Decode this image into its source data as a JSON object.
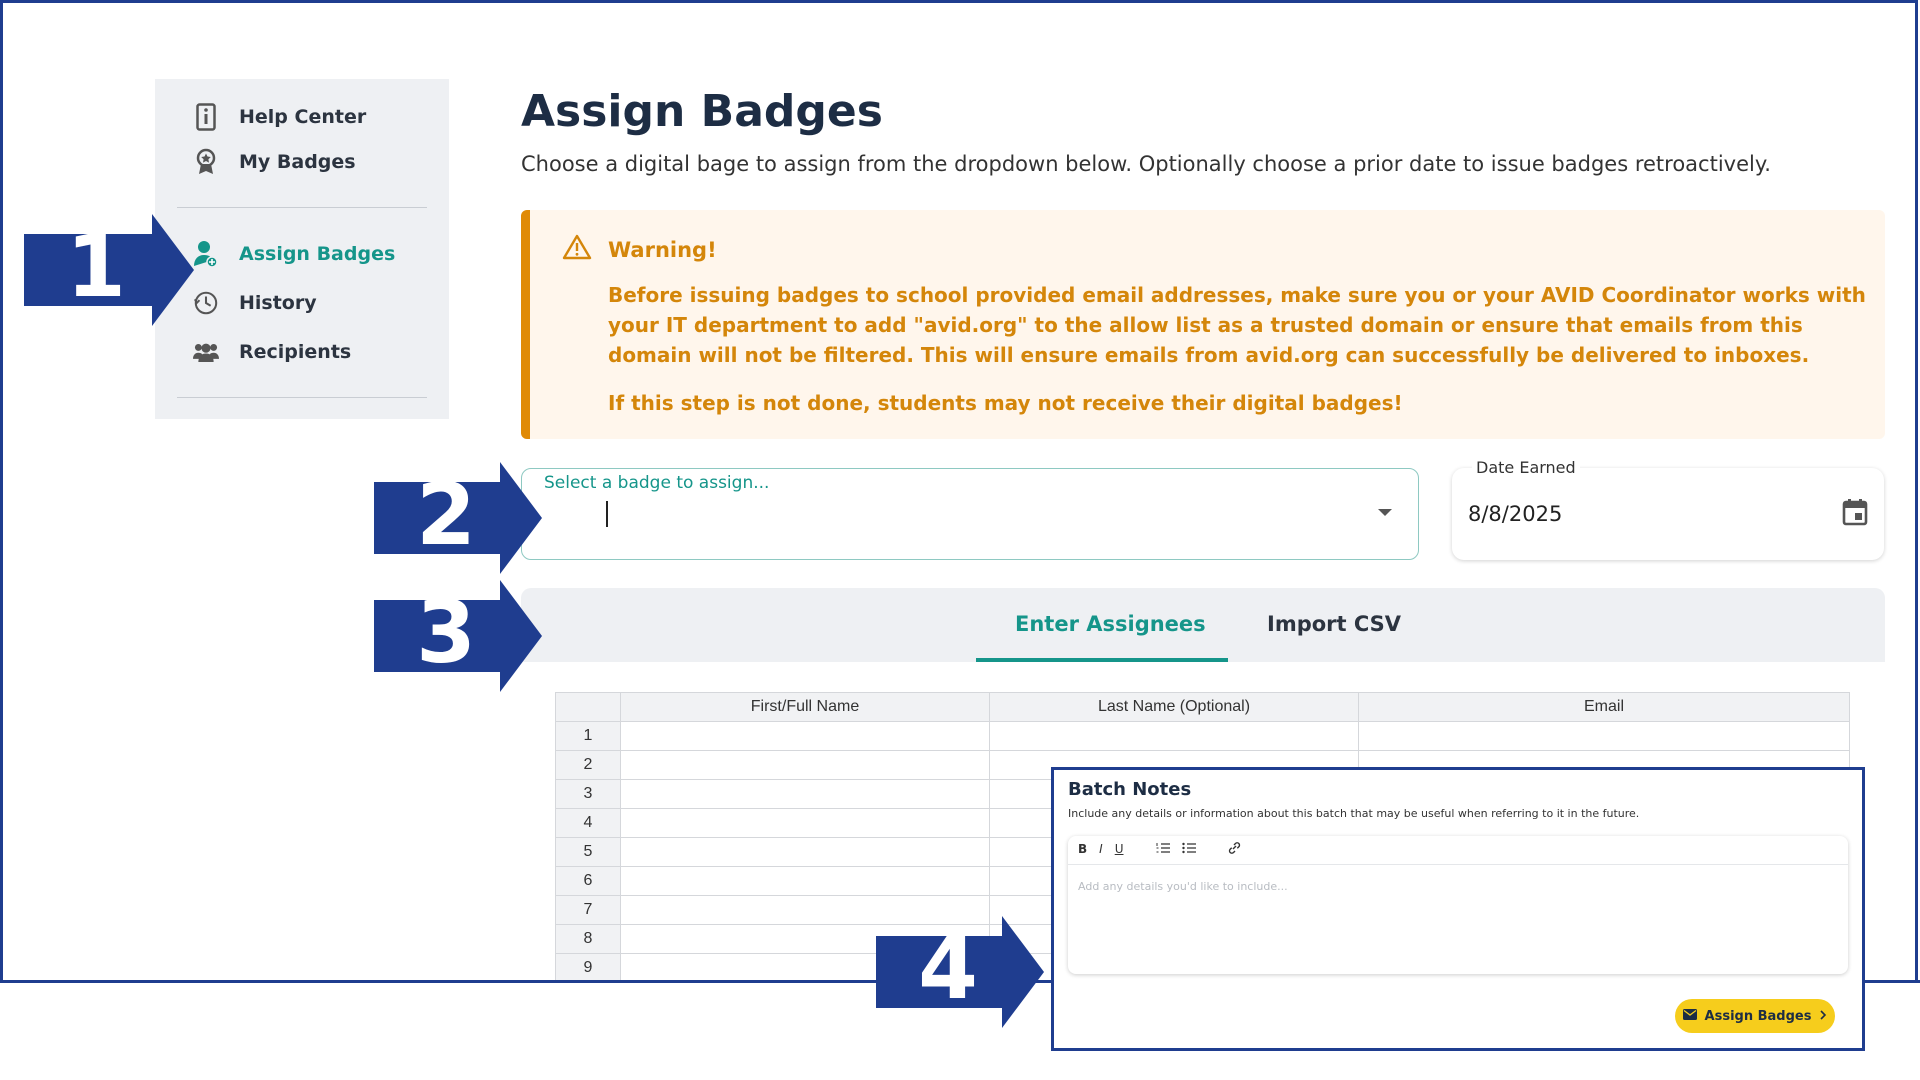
{
  "sidebar": {
    "items": [
      {
        "label": "Help Center",
        "icon": "info-icon"
      },
      {
        "label": "My Badges",
        "icon": "award-icon"
      },
      {
        "label": "Assign Badges",
        "icon": "user-add-icon",
        "active": true
      },
      {
        "label": "History",
        "icon": "clock-history-icon"
      },
      {
        "label": "Recipients",
        "icon": "users-icon"
      }
    ]
  },
  "main": {
    "title": "Assign Badges",
    "subtitle": "Choose a digital bage to assign from the dropdown below. Optionally choose a prior date to issue badges retroactively.",
    "warning": {
      "heading": "Warning!",
      "body": "Before issuing badges to school provided email addresses, make sure you or your AVID Coordinator works with your IT department to add \"avid.org\" to the allow list as a trusted domain or ensure that emails from this domain will not be filtered. This will ensure emails from avid.org can successfully be delivered to inboxes.",
      "note": "If this step is not done, students may not receive their digital badges!"
    },
    "badge_select": {
      "label": "Select a badge to assign..."
    },
    "date": {
      "label": "Date Earned",
      "value": "8/8/2025"
    },
    "tabs": [
      {
        "label": "Enter Assignees",
        "active": true
      },
      {
        "label": "Import CSV"
      }
    ],
    "grid": {
      "columns": [
        "First/Full Name",
        "Last Name (Optional)",
        "Email"
      ],
      "rows": [
        "1",
        "2",
        "3",
        "4",
        "5",
        "6",
        "7",
        "8",
        "9"
      ]
    }
  },
  "callouts": [
    "1",
    "2",
    "3",
    "4"
  ],
  "batch_notes": {
    "title": "Batch Notes",
    "description": "Include any details or information about this batch that may be useful when referring to it in the future.",
    "toolbar": [
      "B",
      "I",
      "U"
    ],
    "placeholder": "Add any details you'd like to include...",
    "submit_label": "Assign Badges"
  },
  "colors": {
    "accent": "#15958a",
    "warning": "#d4860a",
    "callout": "#1f3d8f",
    "button": "#f6cd1c"
  }
}
